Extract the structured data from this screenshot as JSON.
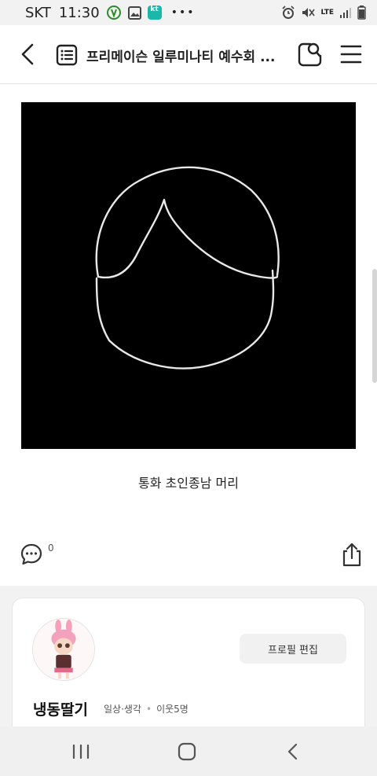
{
  "status_bar": {
    "carrier": "SKT",
    "time": "11:30",
    "kt_badge": "kt",
    "lte": "LTE"
  },
  "header": {
    "title": "프리메이슨 일루미나티 예수회 ..."
  },
  "post": {
    "caption": "통화 초인종남 머리",
    "comment_count": "0"
  },
  "profile": {
    "edit_button": "프로필 편집",
    "nickname": "냉동딸기",
    "category": "일상·생각",
    "neighbors": "이웃5명"
  },
  "icons": {
    "back": "chevron-left-icon",
    "board": "list-board-icon",
    "search": "search-icon",
    "menu": "hamburger-menu-icon",
    "comment": "comment-bubble-icon",
    "share": "share-icon"
  }
}
